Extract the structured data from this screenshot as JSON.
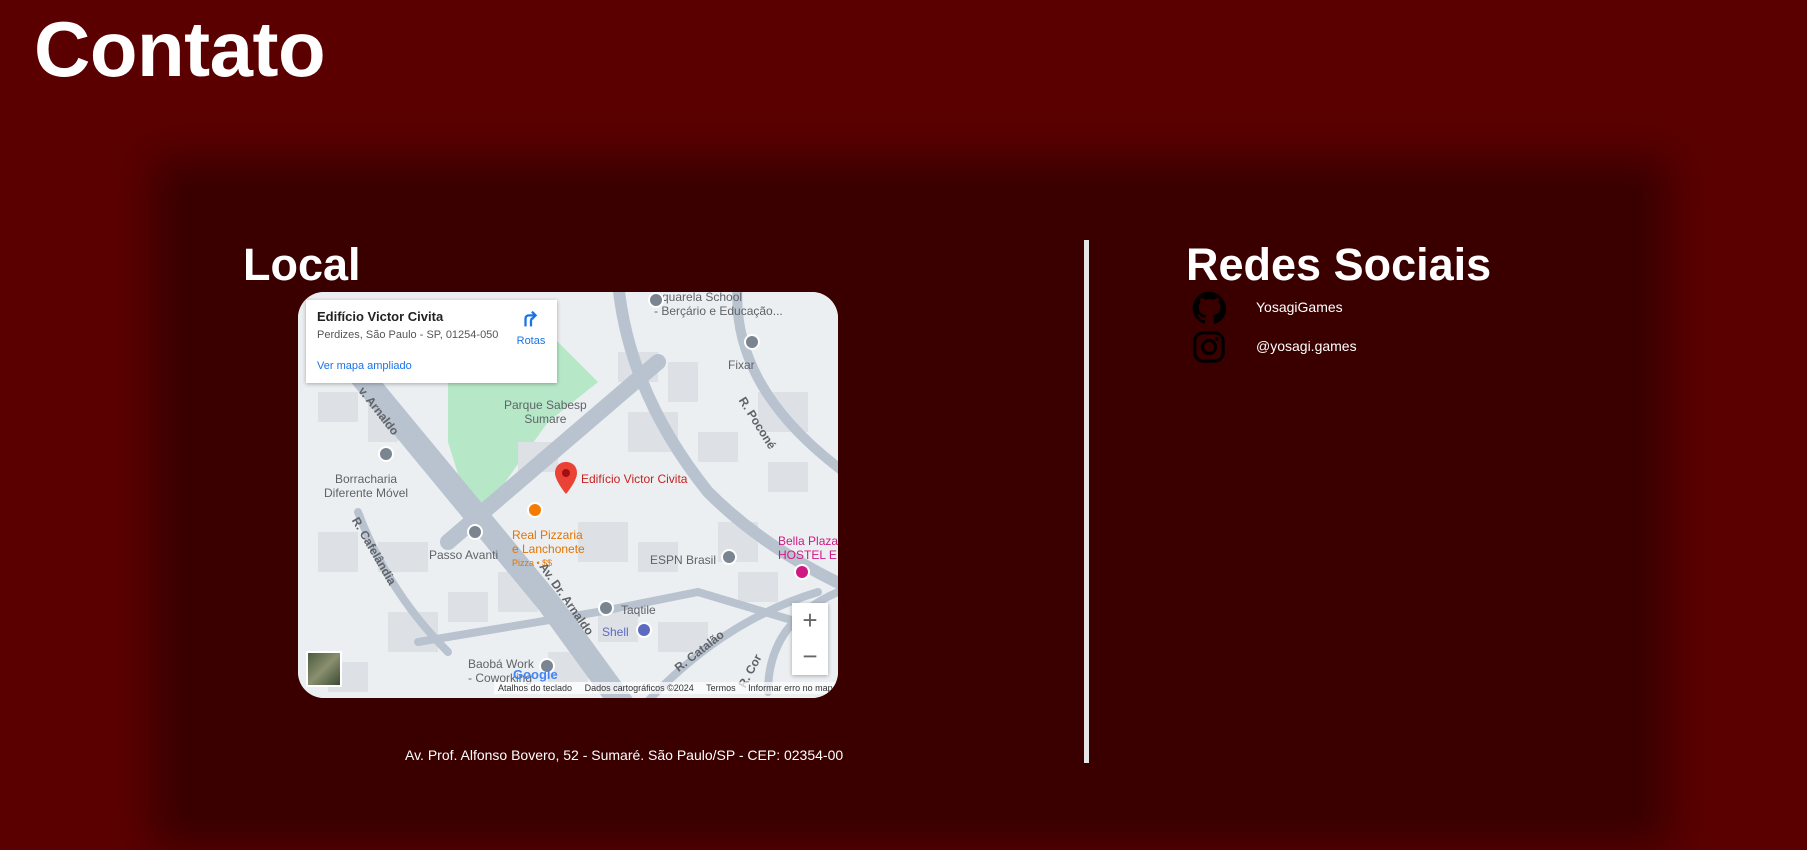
{
  "page_title": "Contato",
  "local": {
    "title": "Local",
    "address": "Av. Prof. Alfonso Bovero, 52 - Sumaré. São Paulo/SP - CEP: 02354-00"
  },
  "map": {
    "info_card": {
      "place_name": "Edifício Victor Civita",
      "place_address": "Perdizes, São Paulo - SP, 01254-050",
      "larger_map_link": "Ver mapa ampliado",
      "directions_label": "Rotas"
    },
    "marker_label": "Edifício Victor Civita",
    "labels": {
      "aquarela": "Aquarela School\n- Berçário e Educação...",
      "parque": "Parque Sabesp\nSumare",
      "fixar": "Fixar",
      "borracharia": "Borracharia\nDiferente Móvel",
      "real_pizzaria": "Real Pizzaria\ne Lanchonete",
      "pizza_price": "Pizza • $$",
      "passo_avanti": "Passo Avanti",
      "espn": "ESPN Brasil",
      "bella_plaza": "Bella Plaza\nHOSTEL E",
      "taqtile": "Taqtile",
      "shell": "Shell",
      "baoba": "Baobá Work\n- Coworking"
    },
    "roads": {
      "arnaldo_top": "v. Arnaldo",
      "arnaldo_main": "Av. Dr. Arnaldo",
      "pocone": "R. Poconé",
      "cafelandia": "R. Cafelândia",
      "catalao": "R. Catalão",
      "cor": "R. Cor"
    },
    "zoom_in": "+",
    "zoom_out": "−",
    "google": "Google",
    "attribution": [
      "Atalhos do teclado",
      "Dados cartográficos ©2024",
      "Termos",
      "Informar erro no mapa"
    ]
  },
  "redes": {
    "title": "Redes Sociais",
    "items": [
      {
        "label": "YosagiGames",
        "icon": "github-icon"
      },
      {
        "label": "@yosagi.games",
        "icon": "instagram-icon"
      }
    ]
  },
  "colors": {
    "background": "#5b0000",
    "panel": "#3a0000",
    "text": "#ffffff",
    "divider": "#e6e6e6",
    "map_marker": "#ea4335"
  }
}
